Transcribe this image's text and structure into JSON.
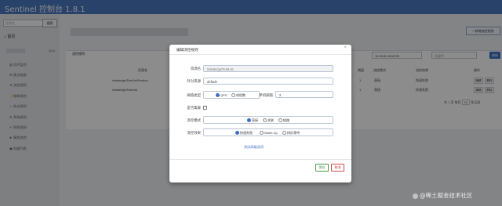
{
  "header": {
    "brand": "Sentinel 控制台 1.8.1"
  },
  "sidebar": {
    "search_placeholder": "应用名",
    "search_button": "搜索",
    "home": "首页",
    "app_count": "(1/1)",
    "items": [
      {
        "icon": "chart-icon",
        "glyph": "▤",
        "label": "实时监控"
      },
      {
        "icon": "list-icon",
        "glyph": "☰",
        "label": "簇点链路"
      },
      {
        "icon": "filter-icon",
        "glyph": "▼",
        "label": "流控规则"
      },
      {
        "icon": "flash-icon",
        "glyph": "⚡",
        "label": "熔断规则"
      },
      {
        "icon": "fire-icon",
        "glyph": "♨",
        "label": "热点规则"
      },
      {
        "icon": "cog-icon",
        "glyph": "⚙",
        "label": "系统规则"
      },
      {
        "icon": "auth-icon",
        "glyph": "✔",
        "label": "授权规则"
      },
      {
        "icon": "cluster-icon",
        "glyph": "◈",
        "label": "集群流控"
      },
      {
        "icon": "machine-icon",
        "glyph": "▣",
        "label": "机器列表"
      }
    ]
  },
  "main": {
    "add_button": "+ 新增流控规则",
    "panel_title": "流控规则",
    "ip_select": "10.10.61.39:8720",
    "keyword_placeholder": "关键字",
    "refresh_button": "刷新",
    "columns": [
      "资源名",
      "阈值",
      "流控模式",
      "流控效果",
      "操作"
    ],
    "rows": [
      {
        "resource": "/sstate/getTestListSentine",
        "threshold": "1",
        "mode": "直接",
        "effect": "快速失败",
        "edit": "编辑",
        "delete": "删除"
      },
      {
        "resource": "/sstate/getTestList",
        "threshold": "1",
        "mode": "直接",
        "effect": "快速失败",
        "edit": "编辑",
        "delete": "删除"
      }
    ],
    "pager": {
      "total_label": "共 1 页",
      "per_page_label": "每页",
      "per_page_value": "10",
      "unit": "条记录"
    }
  },
  "modal": {
    "title": "编辑流控规则",
    "close": "×",
    "fields": {
      "resource_label": "资源名",
      "resource_value": "/sstate/getTestList",
      "limit_app_label": "针对来源",
      "limit_app_value": "default",
      "grade_label": "阈值类型",
      "grade_options": [
        "QPS",
        "线程数"
      ],
      "grade_selected": "QPS",
      "count_label": "单机阈值",
      "count_value": "2",
      "cluster_label": "是否集群",
      "strategy_label": "流控模式",
      "strategy_options": [
        "直接",
        "关联",
        "链路"
      ],
      "strategy_selected": "直接",
      "behavior_label": "流控效果",
      "behavior_options": [
        "快速失败",
        "Warm Up",
        "排队等待"
      ],
      "behavior_selected": "快速失败"
    },
    "advanced_link": "关闭高级选项",
    "save_button": "保存",
    "cancel_button": "取消"
  },
  "watermark": "@稀土掘金技术社区"
}
